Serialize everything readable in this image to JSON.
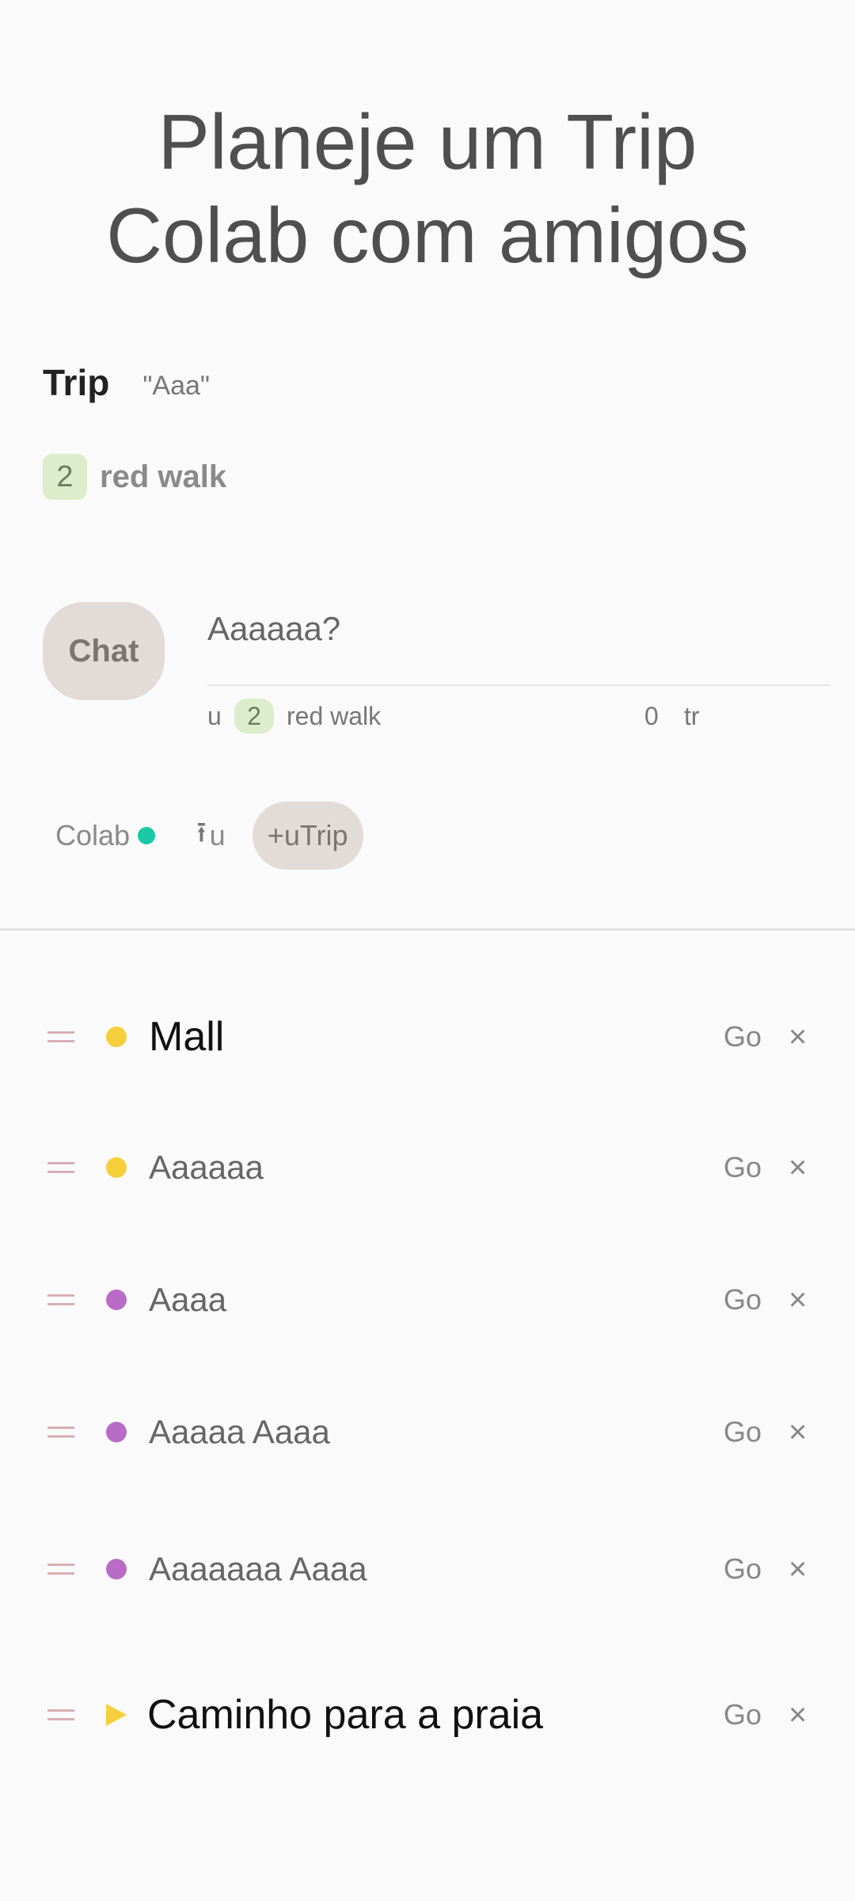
{
  "hero": {
    "line1": "Planeje um Trip",
    "line2": "Colab com amigos"
  },
  "trip": {
    "label": "Trip",
    "name": "\"Aaa\""
  },
  "walk": {
    "count": "2",
    "label": "red walk"
  },
  "chat": {
    "button_label": "Chat",
    "question": "Aaaaaa?",
    "meta_u": "u",
    "meta_count": "2",
    "meta_label": "red walk",
    "meta_zero": "0",
    "meta_tr": "tr"
  },
  "actions": {
    "colab_label": "Colab",
    "upload_icon": "upload-icon",
    "upload_label": "u",
    "add_trip_label": "+uTrip"
  },
  "colors": {
    "teal": "#19c9a6",
    "yellow": "#f7cf3c",
    "purple": "#b96bc8"
  },
  "list": {
    "go_label": "Go",
    "close_icon": "×",
    "items": [
      {
        "label": "Mall",
        "marker": "dot",
        "color": "#f7cf3c"
      },
      {
        "label": "Aaaaaa",
        "marker": "dot",
        "color": "#f7cf3c"
      },
      {
        "label": "Aaaa",
        "marker": "dot",
        "color": "#b96bc8"
      },
      {
        "label": "Aaaaa Aaaa",
        "marker": "dot",
        "color": "#b96bc8"
      },
      {
        "label": "Aaaaaaa Aaaa",
        "marker": "dot",
        "color": "#b96bc8"
      },
      {
        "label": "Caminho para a praia",
        "marker": "triangle",
        "color": "#f7cf3c"
      }
    ]
  }
}
